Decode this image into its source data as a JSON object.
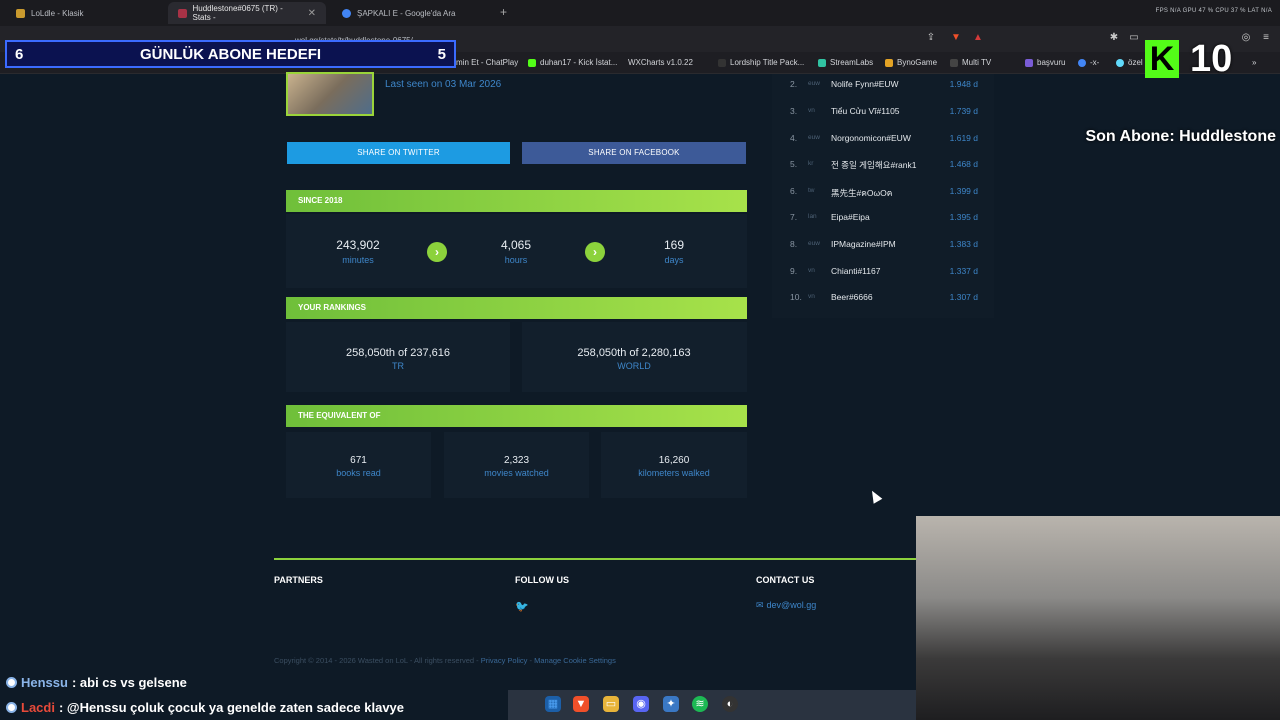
{
  "browser": {
    "tabs": [
      {
        "label": "LoLdle - Klasik"
      },
      {
        "label": "Huddlestone#0675 (TR) - Stats -"
      },
      {
        "label": "ŞAPKALI E - Google'da Ara"
      }
    ],
    "url": "wol.gg/stats/tr/huddlestone-0675/",
    "bookmarks": [
      "min Et - ChatPlay",
      "duhan17 - Kick İstat...",
      "WXCharts v1.0.22",
      "Lordship Title Pack...",
      "StreamLabs",
      "BynoGame",
      "Multi TV",
      "başvuru",
      "-x-",
      "özel"
    ],
    "stats": "FPS N/A   GPU 47 %   CPU 37 %   LAT N/A"
  },
  "overlay": {
    "goal_left": "6",
    "goal_title": "GÜNLÜK ABONE HEDEFI",
    "goal_right": "5",
    "kick_count": "10",
    "last_sub": "Son Abone: Huddlestone"
  },
  "profile": {
    "last_seen": "Last seen on 03 Mar 2026",
    "share_twitter": "SHARE ON TWITTER",
    "share_facebook": "SHARE ON FACEBOOK"
  },
  "since": {
    "title": "SINCE 2018",
    "items": [
      {
        "value": "243,902",
        "label": "minutes"
      },
      {
        "value": "4,065",
        "label": "hours"
      },
      {
        "value": "169",
        "label": "days"
      }
    ]
  },
  "rankings": {
    "title": "YOUR RANKINGS",
    "items": [
      {
        "value": "258,050th of 237,616",
        "label": "TR"
      },
      {
        "value": "258,050th of 2,280,163",
        "label": "WORLD"
      }
    ]
  },
  "equivalent": {
    "title": "THE EQUIVALENT OF",
    "items": [
      {
        "value": "671",
        "label": "books read"
      },
      {
        "value": "2,323",
        "label": "movies watched"
      },
      {
        "value": "16,260",
        "label": "kilometers walked"
      }
    ]
  },
  "leaderboard": [
    {
      "rank": "2.",
      "region": "euw",
      "name": "Nolife Fynn#EUW",
      "score": "1.948 d"
    },
    {
      "rank": "3.",
      "region": "vn",
      "name": "Tiểu Cửu Vĩ#1105",
      "score": "1.739 d"
    },
    {
      "rank": "4.",
      "region": "euw",
      "name": "Norgonomicon#EUW",
      "score": "1.619 d"
    },
    {
      "rank": "5.",
      "region": "kr",
      "name": "전 종일 게임해요#rank1",
      "score": "1.468 d"
    },
    {
      "rank": "6.",
      "region": "tw",
      "name": "黑先生#ฅOωOฅ",
      "score": "1.399 d"
    },
    {
      "rank": "7.",
      "region": "lan",
      "name": "Eipa#Eipa",
      "score": "1.395 d"
    },
    {
      "rank": "8.",
      "region": "euw",
      "name": "IPMagazine#IPM",
      "score": "1.383 d"
    },
    {
      "rank": "9.",
      "region": "vn",
      "name": "Chianti#1167",
      "score": "1.337 d"
    },
    {
      "rank": "10.",
      "region": "vn",
      "name": "Beer#6666",
      "score": "1.307 d"
    }
  ],
  "footer": {
    "partners": "PARTNERS",
    "follow": "FOLLOW US",
    "contact": "CONTACT US",
    "email": "dev@wol.gg",
    "copyright": "Copyright © 2014 - 2026 Wasted on LoL - All rights reserved - ",
    "privacy": "Privacy Policy",
    "sep": " - ",
    "cookie": "Manage Cookie Settings"
  },
  "chat": [
    {
      "user": "Henssu",
      "user_color": "#8ab4e8",
      "message": ": abi cs vs gelsene"
    },
    {
      "user": "Lacdi",
      "user_color": "#e84a3a",
      "message": ": @Henssu çoluk çocuk ya genelde zaten sadece klavye"
    }
  ]
}
